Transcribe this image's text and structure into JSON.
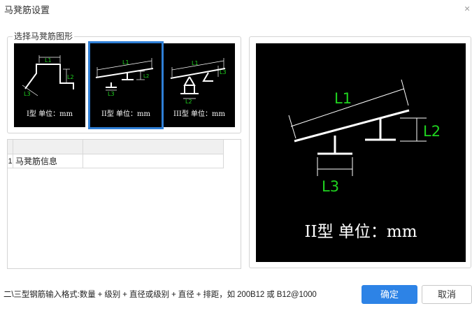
{
  "dialog": {
    "title": "马凳筋设置",
    "close_glyph": "×"
  },
  "shape_group": {
    "legend": "选择马凳筋图形",
    "options": [
      {
        "caption": "I型 单位：mm",
        "selected": false,
        "labels": {
          "l1": "L1",
          "l2": "L2",
          "l3": "L3"
        }
      },
      {
        "caption": "II型 单位：mm",
        "selected": true,
        "labels": {
          "l1": "L1",
          "l2": "L2",
          "l3": "L3"
        }
      },
      {
        "caption": "III型 单位：mm",
        "selected": false,
        "labels": {
          "l1": "L1",
          "l2": "L2",
          "l3": "L3"
        }
      }
    ]
  },
  "grid": {
    "rows": [
      {
        "num": "1",
        "name": "马凳筋信息",
        "value": ""
      }
    ]
  },
  "preview": {
    "caption": "II型 单位：mm",
    "labels": {
      "l1": "L1",
      "l2": "L2",
      "l3": "L3"
    }
  },
  "footer": {
    "hint": "二\\三型钢筋输入格式:数量 + 级别 + 直径或级别 + 直径 + 排距，如 200B12 或 B12@1000",
    "ok_label": "确定",
    "cancel_label": "取消"
  },
  "colors": {
    "accent": "#2d83e6",
    "dimension_green": "#1fd21f",
    "canvas_bg": "#000000"
  }
}
